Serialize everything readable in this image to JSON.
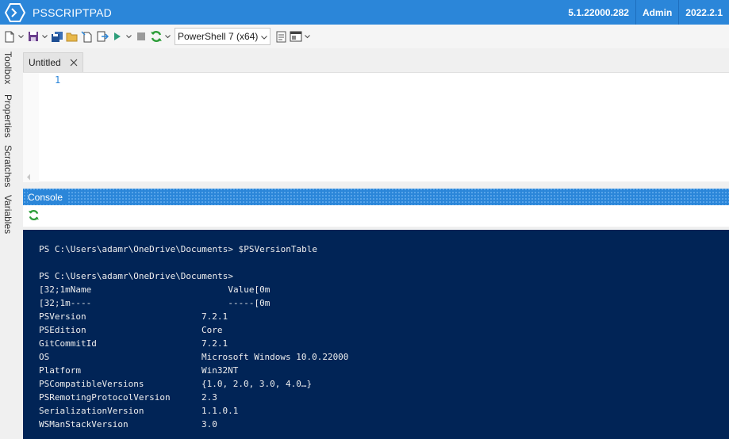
{
  "titlebar": {
    "app_title": "PSSCRIPTPAD",
    "version": "5.1.22000.282",
    "role": "Admin",
    "build": "2022.2.1"
  },
  "toolbar": {
    "powershell_select": "PowerShell 7 (x64)"
  },
  "sidebar": {
    "tabs": [
      "Toolbox",
      "Properties",
      "Scratches",
      "Variables"
    ]
  },
  "editor": {
    "tab_title": "Untitled",
    "line_number": "1"
  },
  "console": {
    "title": "Console",
    "prompt_line": "PS C:\\Users\\adamr\\OneDrive\\Documents> $PSVersionTable",
    "prompt_line2": "PS C:\\Users\\adamr\\OneDrive\\Documents>",
    "header_line": "[32;1mName                          Value[0m",
    "underline_line": "[32;1m----                          -----[0m",
    "rows": [
      {
        "name": "PSVersion",
        "value": "7.2.1"
      },
      {
        "name": "PSEdition",
        "value": "Core"
      },
      {
        "name": "GitCommitId",
        "value": "7.2.1"
      },
      {
        "name": "OS",
        "value": "Microsoft Windows 10.0.22000"
      },
      {
        "name": "Platform",
        "value": "Win32NT"
      },
      {
        "name": "PSCompatibleVersions",
        "value": "{1.0, 2.0, 3.0, 4.0…}"
      },
      {
        "name": "PSRemotingProtocolVersion",
        "value": "2.3"
      },
      {
        "name": "SerializationVersion",
        "value": "1.1.0.1"
      },
      {
        "name": "WSManStackVersion",
        "value": "3.0"
      }
    ]
  },
  "colors": {
    "accent": "#2b86d9",
    "console_bg": "#012456"
  }
}
